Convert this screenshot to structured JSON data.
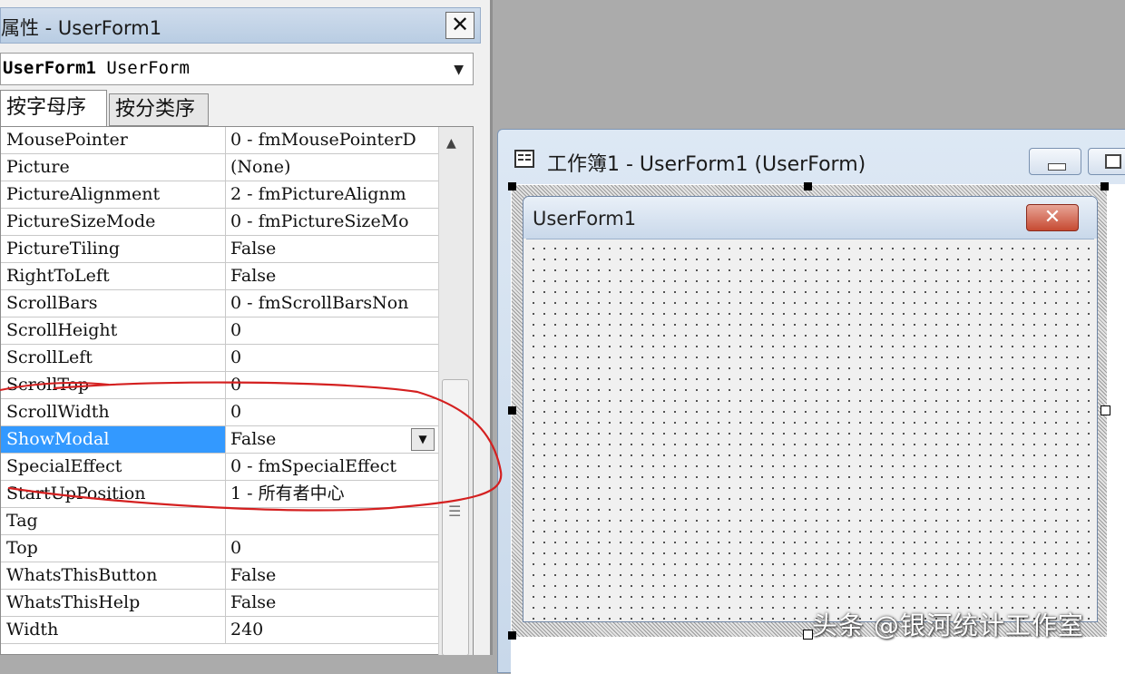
{
  "props_panel": {
    "title": "属性 - UserForm1",
    "close_glyph": "✕",
    "object_name": "UserForm1",
    "object_type": "UserForm",
    "tabs": [
      {
        "label": "按字母序"
      },
      {
        "label": "按分类序"
      }
    ],
    "properties": [
      {
        "name": "MousePointer",
        "value": "0 - fmMousePointerD"
      },
      {
        "name": "Picture",
        "value": "(None)"
      },
      {
        "name": "PictureAlignment",
        "value": "2 - fmPictureAlignm"
      },
      {
        "name": "PictureSizeMode",
        "value": "0 - fmPictureSizeMo"
      },
      {
        "name": "PictureTiling",
        "value": "False"
      },
      {
        "name": "RightToLeft",
        "value": "False"
      },
      {
        "name": "ScrollBars",
        "value": "0 - fmScrollBarsNon"
      },
      {
        "name": "ScrollHeight",
        "value": "0"
      },
      {
        "name": "ScrollLeft",
        "value": "0"
      },
      {
        "name": "ScrollTop",
        "value": "0"
      },
      {
        "name": "ScrollWidth",
        "value": "0"
      },
      {
        "name": "ShowModal",
        "value": "False"
      },
      {
        "name": "SpecialEffect",
        "value": "0 - fmSpecialEffect"
      },
      {
        "name": "StartUpPosition",
        "value": "1 - 所有者中心"
      },
      {
        "name": "Tag",
        "value": ""
      },
      {
        "name": "Top",
        "value": "0"
      },
      {
        "name": "WhatsThisButton",
        "value": "False"
      },
      {
        "name": "WhatsThisHelp",
        "value": "False"
      },
      {
        "name": "Width",
        "value": "240"
      }
    ],
    "selected_property": "ShowModal"
  },
  "designer": {
    "title": "工作簿1 - UserForm1 (UserForm)",
    "userform": {
      "caption": "UserForm1",
      "close_glyph": "✕"
    }
  },
  "watermark": "头条 @银河统计工作室",
  "colors": {
    "selection": "#3399ff",
    "annotation": "#d42020",
    "close_button": "#c64a32"
  }
}
